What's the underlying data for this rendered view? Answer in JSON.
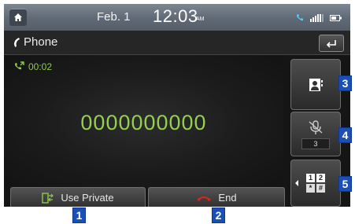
{
  "status_bar": {
    "date": "Feb.  1",
    "time": "12:03",
    "ampm": "AM",
    "icons": [
      "home-icon",
      "bluetooth-phone-icon",
      "signal-strength-icon",
      "battery-icon"
    ]
  },
  "title_bar": {
    "title": "Phone",
    "icon": "phone-handset-icon",
    "back_icon": "back-arrow-icon"
  },
  "call": {
    "duration": "00:02",
    "number": "0000000000",
    "call_icon": "outgoing-call-icon"
  },
  "side_buttons": {
    "contacts_icon": "contacts-icon",
    "mic_mute_icon": "mic-mute-icon",
    "mic_level": "3",
    "keypad_icon": "dial-keypad-icon",
    "keypad_keys": [
      "1",
      "2",
      "*",
      "#"
    ]
  },
  "bottom_buttons": {
    "use_private": "Use Private",
    "end": "End"
  },
  "badges": [
    "1",
    "2",
    "3",
    "4",
    "5"
  ],
  "colors": {
    "call_green": "#94cf4d",
    "end_red": "#e0231a",
    "badge_blue": "#1b4fb8"
  }
}
